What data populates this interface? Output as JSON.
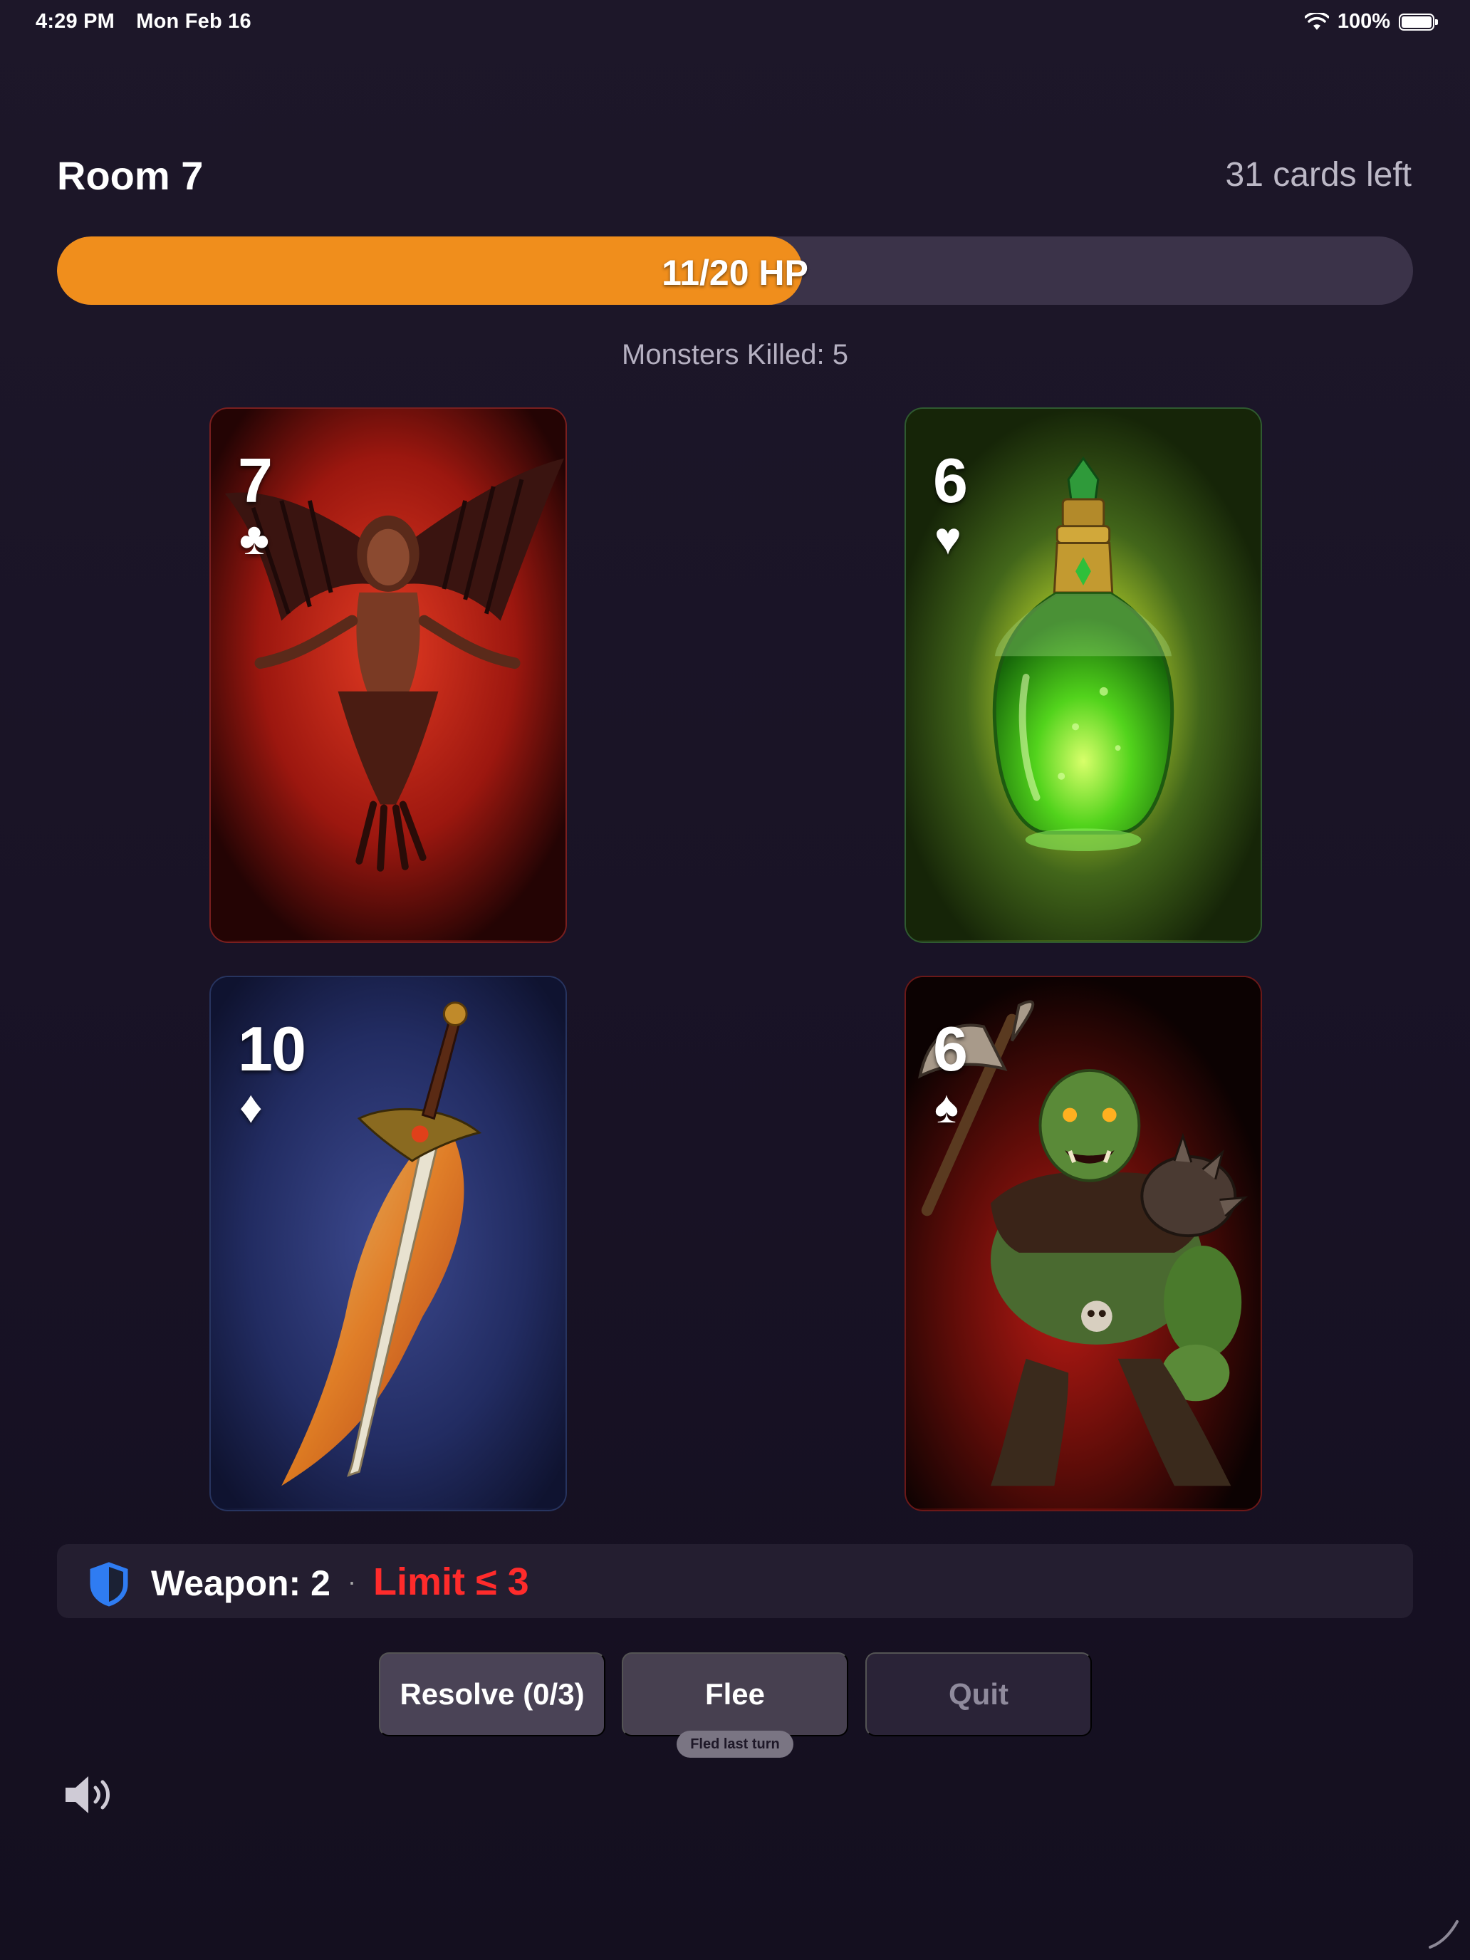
{
  "status_bar": {
    "time": "4:29 PM",
    "date": "Mon Feb 16",
    "battery": "100%",
    "wifi_icon": "wifi-icon",
    "battery_icon": "battery-full-icon"
  },
  "header": {
    "room": "Room 7",
    "cards_left": "31 cards left"
  },
  "hp": {
    "current": 11,
    "max": 20,
    "fraction": 0.55,
    "label": "11/20 HP",
    "fill_color": "#f08e1c"
  },
  "monsters_killed": "Monsters Killed: 5",
  "cards": [
    {
      "value": "7",
      "suit": "♣",
      "suit_name": "clubs",
      "art": "harpy-monster"
    },
    {
      "value": "6",
      "suit": "♥",
      "suit_name": "hearts",
      "art": "green-potion"
    },
    {
      "value": "10",
      "suit": "♦",
      "suit_name": "diamonds",
      "art": "flaming-sword"
    },
    {
      "value": "6",
      "suit": "♠",
      "suit_name": "spades",
      "art": "orc-warrior"
    }
  ],
  "weapon": {
    "label": "Weapon: 2",
    "separator": "·",
    "limit": "Limit ≤ 3",
    "limit_color": "#ff2b2b",
    "icon": "shield-icon"
  },
  "buttons": {
    "resolve": "Resolve (0/3)",
    "flee": "Flee",
    "quit": "Quit",
    "flee_note": "Fled last turn"
  },
  "sound_icon": "speaker-icon"
}
